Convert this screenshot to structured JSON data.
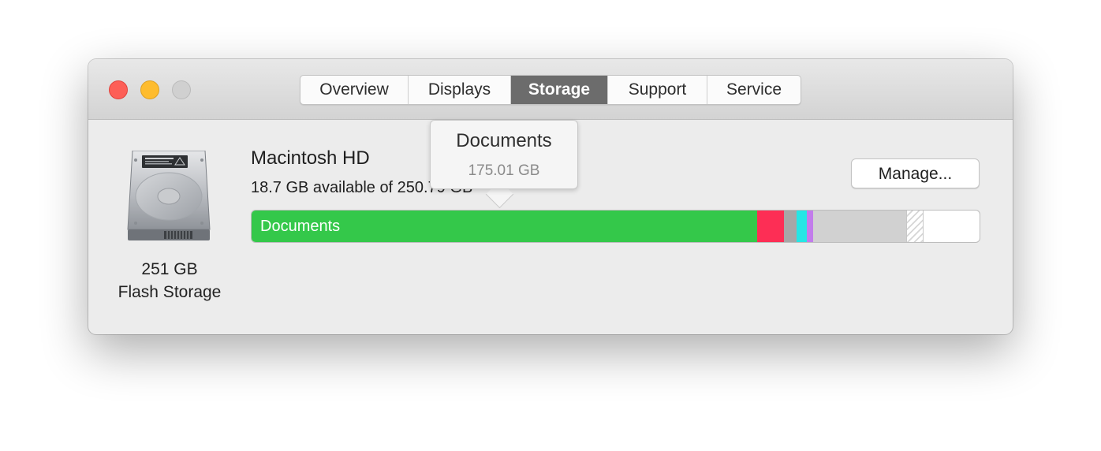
{
  "window": {
    "traffic_lights": [
      "close-icon",
      "minimize-icon",
      "zoom-icon"
    ]
  },
  "tabs": [
    {
      "label": "Overview",
      "active": false
    },
    {
      "label": "Displays",
      "active": false
    },
    {
      "label": "Storage",
      "active": true
    },
    {
      "label": "Support",
      "active": false
    },
    {
      "label": "Service",
      "active": false
    }
  ],
  "disk": {
    "icon": "hard-drive-icon",
    "capacity": "251 GB",
    "type": "Flash Storage"
  },
  "volume": {
    "name": "Macintosh HD",
    "available_text": "18.7 GB available of 250.79 GB"
  },
  "manage_button": {
    "label": "Manage..."
  },
  "storage_bar": {
    "segments": [
      {
        "name": "Documents",
        "label": "Documents",
        "fraction": 0.6942,
        "color": "#34c84a"
      },
      {
        "name": "segment-red",
        "label": "",
        "fraction": 0.0368,
        "color": "#fd2e55"
      },
      {
        "name": "segment-gray",
        "label": "",
        "fraction": 0.0173,
        "color": "#a7a7a7"
      },
      {
        "name": "segment-cyan",
        "label": "",
        "fraction": 0.0141,
        "color": "#25e6e5"
      },
      {
        "name": "segment-purple",
        "label": "",
        "fraction": 0.0087,
        "color": "#c27ceb"
      },
      {
        "name": "segment-other",
        "label": "",
        "fraction": 0.1276,
        "color": "#d1d1d1"
      },
      {
        "name": "segment-purgeable",
        "label": "",
        "fraction": 0.0238,
        "color": "hatched"
      }
    ]
  },
  "tooltip": {
    "title": "Documents",
    "size": "175.01 GB"
  }
}
